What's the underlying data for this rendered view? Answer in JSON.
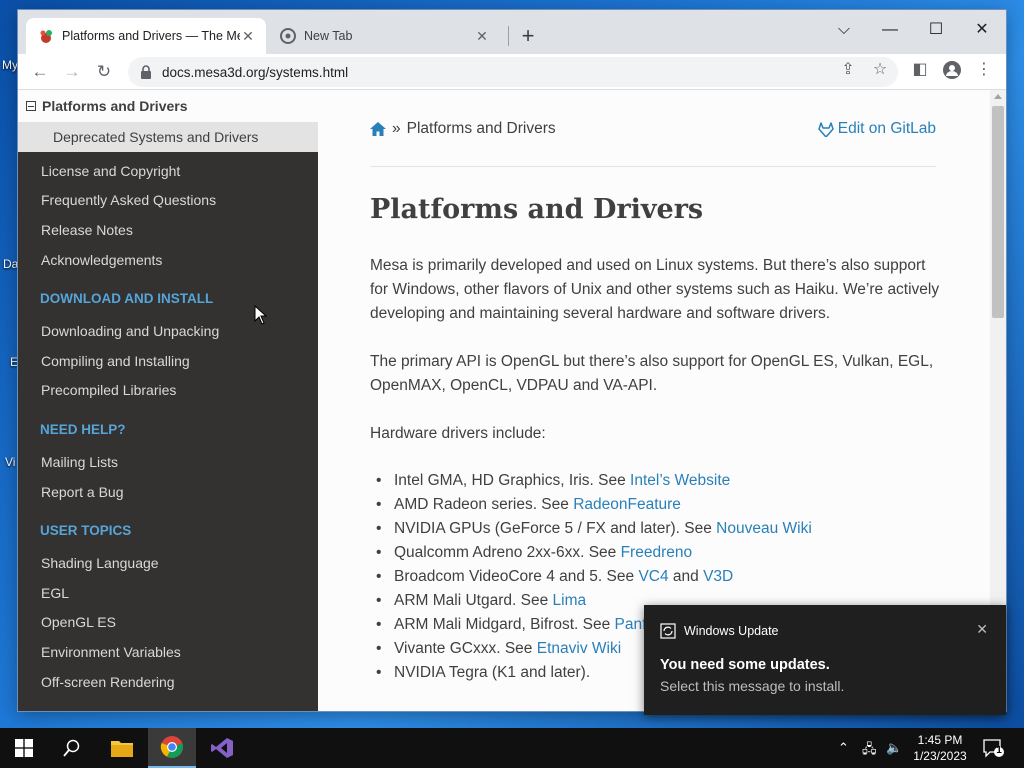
{
  "desktop": {
    "fragments": [
      "My",
      "Da",
      "E",
      "Vi"
    ]
  },
  "browser": {
    "tabs": [
      {
        "title": "Platforms and Drivers — The Me",
        "active": true
      },
      {
        "title": "New Tab",
        "active": false
      }
    ],
    "url": "docs.mesa3d.org/systems.html"
  },
  "sidebar": {
    "current": "Platforms and Drivers",
    "current_sub": "Deprecated Systems and Drivers",
    "group1": [
      "License and Copyright",
      "Frequently Asked Questions",
      "Release Notes",
      "Acknowledgements"
    ],
    "caption_download": "DOWNLOAD AND INSTALL",
    "group2": [
      "Downloading and Unpacking",
      "Compiling and Installing",
      "Precompiled Libraries"
    ],
    "caption_help": "NEED HELP?",
    "group3": [
      "Mailing Lists",
      "Report a Bug"
    ],
    "caption_user": "USER TOPICS",
    "group4": [
      "Shading Language",
      "EGL",
      "OpenGL ES",
      "Environment Variables",
      "Off-screen Rendering"
    ]
  },
  "article": {
    "crumb_sep": "»",
    "crumb_title": "Platforms and Drivers",
    "edit_label": "Edit on GitLab",
    "title": "Platforms and Drivers",
    "para1": "Mesa is primarily developed and used on Linux systems. But there’s also support for Windows, other flavors of Unix and other systems such as Haiku. We’re actively developing and maintaining several hardware and software drivers.",
    "para2": "The primary API is OpenGL but there’s also support for OpenGL ES, Vulkan, EGL, OpenMAX, OpenCL, VDPAU and VA-API.",
    "para3": "Hardware drivers include:",
    "drivers": [
      {
        "text": "Intel GMA, HD Graphics, Iris. See ",
        "links": [
          "Intel’s Website"
        ],
        "tail": ""
      },
      {
        "text": "AMD Radeon series. See ",
        "links": [
          "RadeonFeature"
        ],
        "tail": ""
      },
      {
        "text": "NVIDIA GPUs (GeForce 5 / FX and later). See ",
        "links": [
          "Nouveau Wiki"
        ],
        "tail": ""
      },
      {
        "text": "Qualcomm Adreno 2xx-6xx. See ",
        "links": [
          "Freedreno"
        ],
        "tail": ""
      },
      {
        "text": "Broadcom VideoCore 4 and 5. See ",
        "links": [
          "VC4",
          "V3D"
        ],
        "tail": ""
      },
      {
        "text": "ARM Mali Utgard. See ",
        "links": [
          "Lima"
        ],
        "tail": ""
      },
      {
        "text": "ARM Mali Midgard, Bifrost. See ",
        "links": [
          "Panfrost"
        ],
        "tail": ""
      },
      {
        "text": "Vivante GCxxx. See ",
        "links": [
          "Etnaviv Wiki"
        ],
        "tail": ""
      },
      {
        "text": "NVIDIA Tegra (K1 and later).",
        "links": [],
        "tail": ""
      }
    ],
    "link_joiner": " and "
  },
  "toast": {
    "app": "Windows Update",
    "title": "You need some updates.",
    "body": "Select this message to install."
  },
  "taskbar": {
    "time": "1:45 PM",
    "date": "1/23/2023",
    "notification_count": "1"
  },
  "colors": {
    "link": "#2980b9",
    "caption": "#55a5d9",
    "sidebar_bg": "#343131"
  }
}
